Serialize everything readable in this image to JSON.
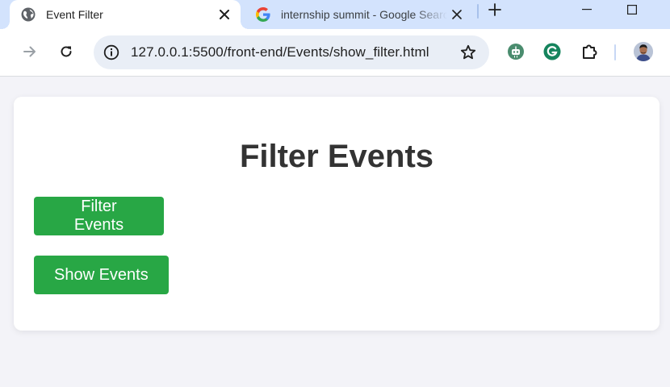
{
  "browser": {
    "tabs": [
      {
        "title": "Event Filter",
        "icon": "globe-icon",
        "active": true
      },
      {
        "title": "internship summit - Google Search",
        "icon": "google-icon",
        "active": false
      }
    ],
    "url": "127.0.0.1:5500/front-end/Events/show_filter.html",
    "accent_color": "#d3e3fd"
  },
  "page": {
    "heading": "Filter Events",
    "buttons": {
      "filter_label": "Filter Events",
      "show_label": "Show Events"
    },
    "button_color": "#28a745",
    "background": "#f3f3f8"
  }
}
